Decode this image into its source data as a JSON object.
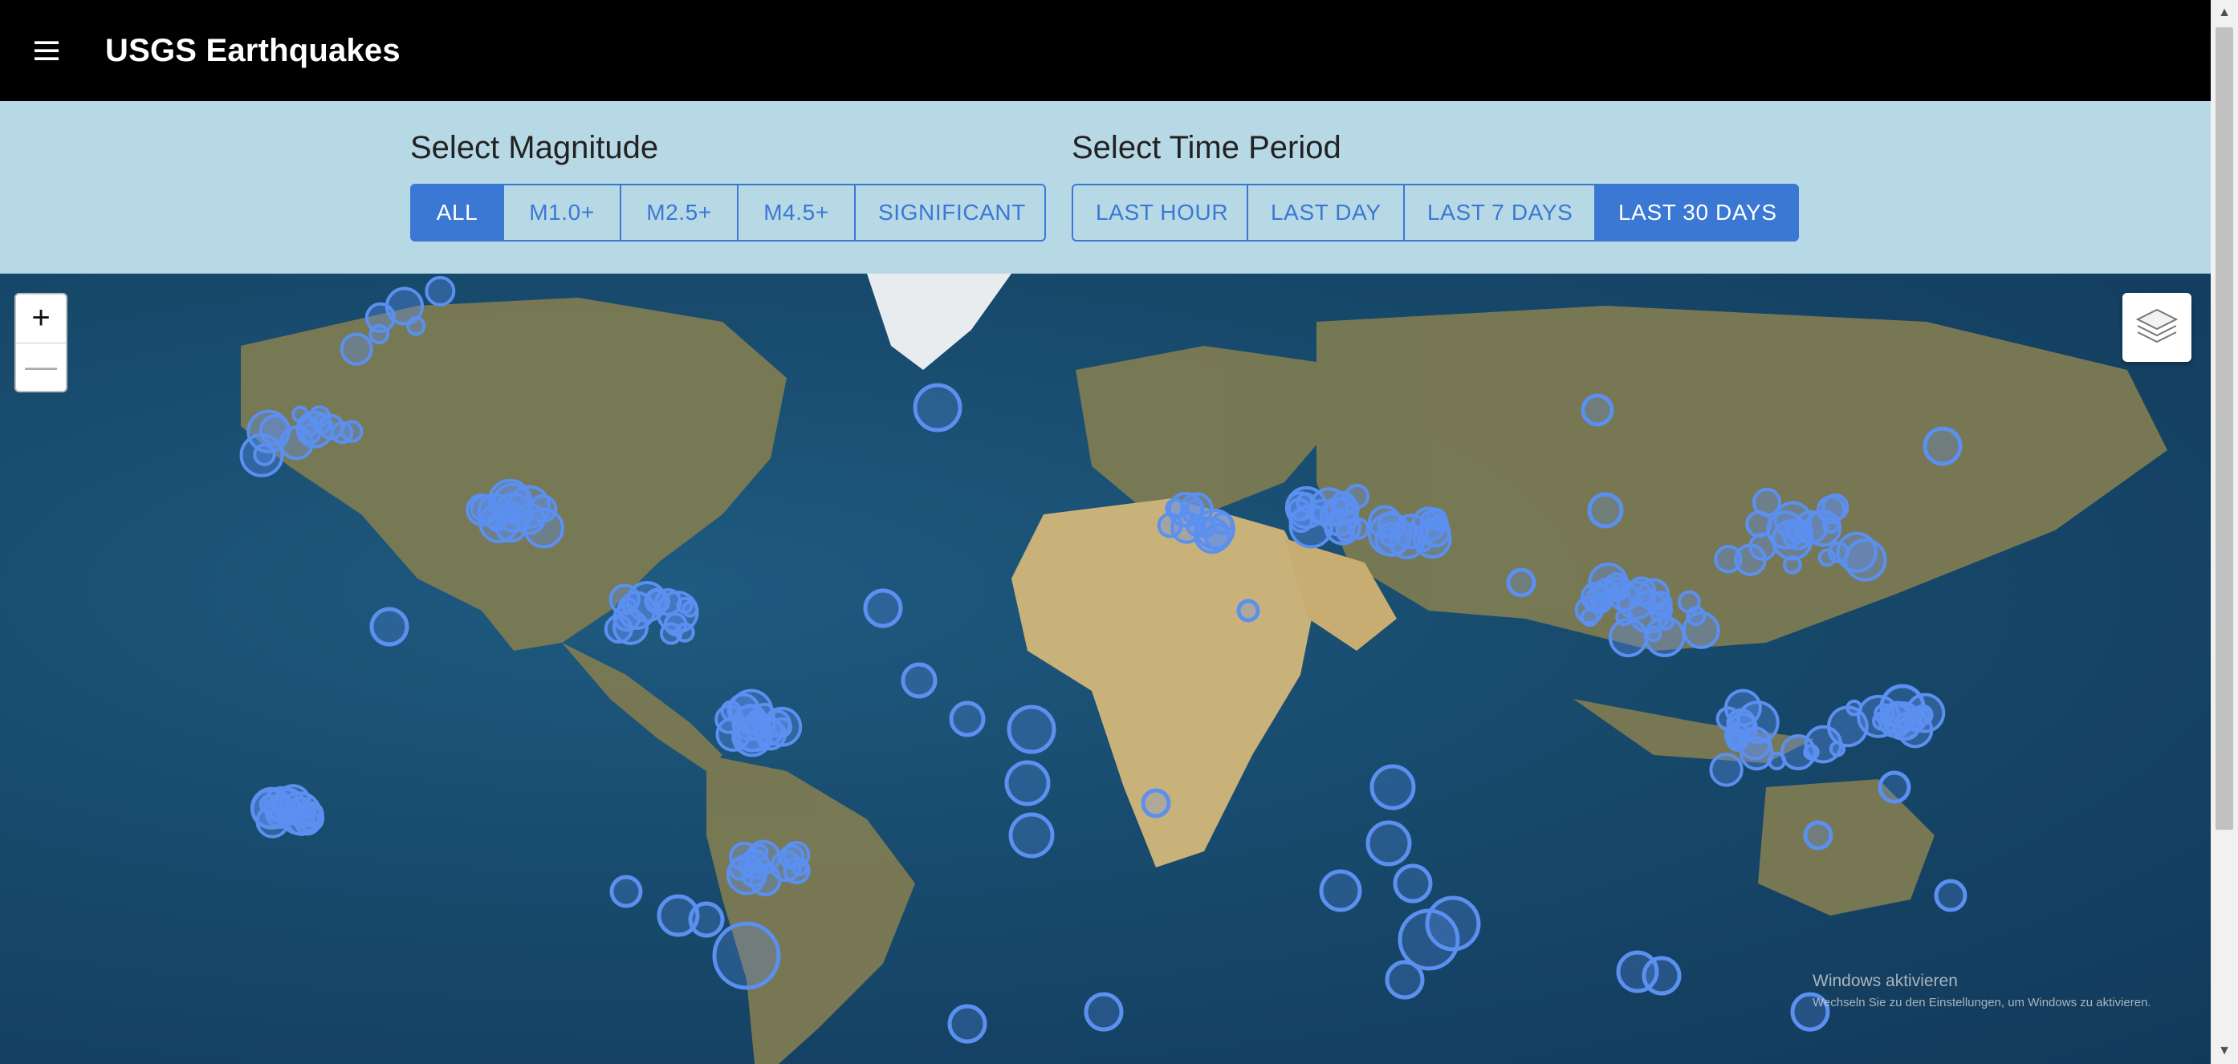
{
  "app": {
    "title": "USGS Earthquakes"
  },
  "magnitude": {
    "heading": "Select Magnitude",
    "options": [
      "ALL",
      "M1.0+",
      "M2.5+",
      "M4.5+",
      "SIGNIFICANT"
    ],
    "selected": "ALL"
  },
  "time_period": {
    "heading": "Select Time Period",
    "options": [
      "LAST HOUR",
      "LAST DAY",
      "LAST 7 DAYS",
      "LAST 30 DAYS"
    ],
    "selected": "LAST 30 DAYS"
  },
  "map": {
    "zoom_in_label": "+",
    "zoom_out_label": "—",
    "layers_icon": "layers-icon",
    "marker_color": "#5b8ff0"
  },
  "watermark": {
    "line1": "Windows aktivieren",
    "line2": "Wechseln Sie zu den Einstellungen, um Windows zu aktivieren."
  },
  "colors": {
    "topbar": "#000000",
    "filter_panel": "#b7d9e6",
    "accent": "#3a78d4",
    "ocean": "#174a6c"
  }
}
